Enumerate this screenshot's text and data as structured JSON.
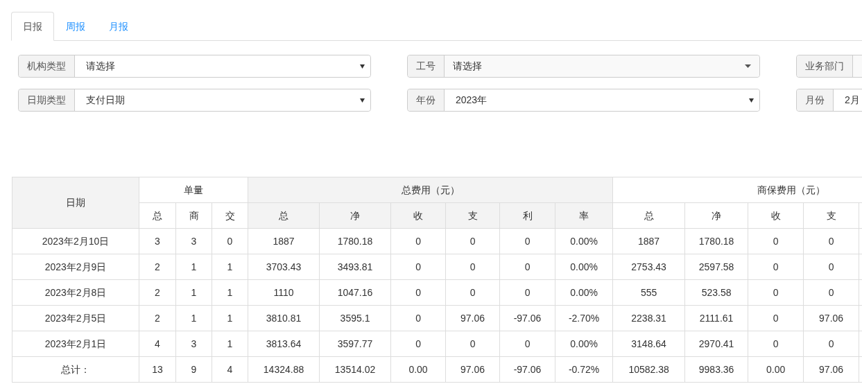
{
  "tabs": [
    {
      "label": "日报",
      "selected": true
    },
    {
      "label": "周报",
      "selected": false
    },
    {
      "label": "月报",
      "selected": false
    }
  ],
  "filters": [
    [
      {
        "label": "机构类型",
        "value": "请选择",
        "kind": "native"
      },
      {
        "label": "工号",
        "value": "请选择",
        "kind": "picker"
      },
      {
        "label": "业务部门",
        "kind": "picker"
      }
    ],
    [
      {
        "label": "日期类型",
        "value": "支付日期",
        "kind": "native"
      },
      {
        "label": "年份",
        "value": "2023年",
        "kind": "native"
      },
      {
        "label": "月份",
        "value": "2月",
        "kind": "native"
      }
    ]
  ],
  "table": {
    "date_header": "日期",
    "groups": [
      {
        "label": "单量",
        "shaded": false,
        "columns": [
          "总",
          "商",
          "交"
        ]
      },
      {
        "label": "总费用（元）",
        "shaded": true,
        "columns": [
          "总",
          "净",
          "收",
          "支",
          "利",
          "率"
        ]
      },
      {
        "label": "商保费用（元）",
        "shaded": false,
        "columns": [
          "总",
          "净",
          "收",
          "支"
        ]
      }
    ],
    "rows": [
      [
        "2023年2月10日",
        "3",
        "3",
        "0",
        "1887",
        "1780.18",
        "0",
        "0",
        "0",
        "0.00%",
        "1887",
        "1780.18",
        "0",
        "0"
      ],
      [
        "2023年2月9日",
        "2",
        "1",
        "1",
        "3703.43",
        "3493.81",
        "0",
        "0",
        "0",
        "0.00%",
        "2753.43",
        "2597.58",
        "0",
        "0"
      ],
      [
        "2023年2月8日",
        "2",
        "1",
        "1",
        "1110",
        "1047.16",
        "0",
        "0",
        "0",
        "0.00%",
        "555",
        "523.58",
        "0",
        "0"
      ],
      [
        "2023年2月5日",
        "2",
        "1",
        "1",
        "3810.81",
        "3595.1",
        "0",
        "97.06",
        "-97.06",
        "-2.70%",
        "2238.31",
        "2111.61",
        "0",
        "97.06"
      ],
      [
        "2023年2月1日",
        "4",
        "3",
        "1",
        "3813.64",
        "3597.77",
        "0",
        "0",
        "0",
        "0.00%",
        "3148.64",
        "2970.41",
        "0",
        "0"
      ],
      [
        "总计：",
        "13",
        "9",
        "4",
        "14324.88",
        "13514.02",
        "0.00",
        "97.06",
        "-97.06",
        "-0.72%",
        "10582.38",
        "9983.36",
        "0.00",
        "97.06"
      ]
    ]
  }
}
